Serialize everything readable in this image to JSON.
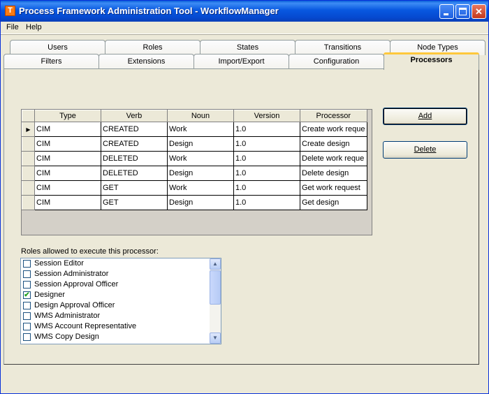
{
  "window": {
    "title": "Process Framework Administration Tool - WorkflowManager",
    "app_icon_letter": "T"
  },
  "menu": {
    "items": [
      "File",
      "Help"
    ]
  },
  "tabs": {
    "row1": [
      "Users",
      "Roles",
      "States",
      "Transitions",
      "Node Types"
    ],
    "row2": [
      "Filters",
      "Extensions",
      "Import/Export",
      "Configuration",
      "Processors"
    ],
    "active": "Processors"
  },
  "grid": {
    "columns": [
      "Type",
      "Verb",
      "Noun",
      "Version",
      "Processor"
    ],
    "rows": [
      [
        "CIM",
        "CREATED",
        "Work",
        "1.0",
        "Create work reque"
      ],
      [
        "CIM",
        "CREATED",
        "Design",
        "1.0",
        "Create design"
      ],
      [
        "CIM",
        "DELETED",
        "Work",
        "1.0",
        "Delete work reque"
      ],
      [
        "CIM",
        "DELETED",
        "Design",
        "1.0",
        "Delete design"
      ],
      [
        "CIM",
        "GET",
        "Work",
        "1.0",
        "Get work request"
      ],
      [
        "CIM",
        "GET",
        "Design",
        "1.0",
        "Get design"
      ]
    ],
    "current_row_marker": "▶"
  },
  "buttons": {
    "add": "Add",
    "delete": "Delete"
  },
  "roles": {
    "label": "Roles allowed to execute this processor:",
    "items": [
      {
        "label": "Session Editor",
        "checked": false
      },
      {
        "label": "Session Administrator",
        "checked": false
      },
      {
        "label": "Session Approval Officer",
        "checked": false
      },
      {
        "label": "Designer",
        "checked": true
      },
      {
        "label": "Design Approval Officer",
        "checked": false
      },
      {
        "label": "WMS Administrator",
        "checked": false
      },
      {
        "label": "WMS Account Representative",
        "checked": false
      },
      {
        "label": "WMS Copy Design",
        "checked": false
      }
    ]
  }
}
